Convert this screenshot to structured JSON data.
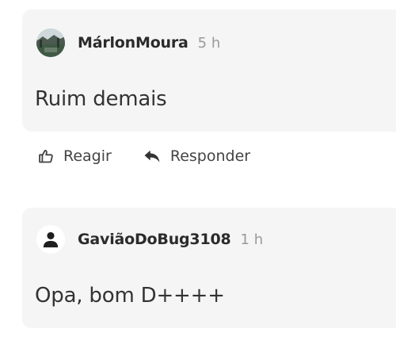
{
  "comments": [
    {
      "username": "MárlonMoura",
      "time": "5 h",
      "message": "Ruim demais",
      "avatar_icon": "photo-avatar"
    },
    {
      "username": "GaviãoDoBug3108",
      "time": "1 h",
      "message": "Opa, bom D++++",
      "avatar_icon": "user-silhouette-icon"
    }
  ],
  "actions": {
    "react_label": "Reagir",
    "react_icon": "thumbs-up-icon",
    "reply_label": "Responder",
    "reply_icon": "reply-arrow-icon"
  }
}
